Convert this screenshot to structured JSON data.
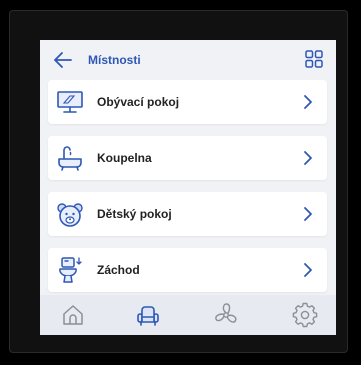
{
  "header": {
    "title": "Místnosti",
    "back_icon": "arrow-left-icon",
    "view_icon": "grid-icon"
  },
  "rooms": [
    {
      "label": "Obývací pokoj",
      "icon": "monitor-icon"
    },
    {
      "label": "Koupelna",
      "icon": "bathtub-icon"
    },
    {
      "label": "Dětský pokoj",
      "icon": "teddy-bear-icon"
    },
    {
      "label": "Záchod",
      "icon": "toilet-icon"
    }
  ],
  "bottom_nav": [
    {
      "name": "home",
      "icon": "home-icon",
      "active": false
    },
    {
      "name": "rooms",
      "icon": "armchair-icon",
      "active": true
    },
    {
      "name": "fan",
      "icon": "fan-icon",
      "active": false
    },
    {
      "name": "settings",
      "icon": "gear-icon",
      "active": false
    }
  ],
  "colors": {
    "accent": "#2f57b5",
    "icon_inactive": "#8c8f96",
    "background": "#f0f2f6",
    "card": "#ffffff"
  }
}
